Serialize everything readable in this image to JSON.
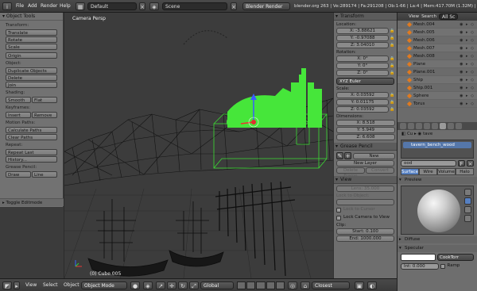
{
  "topbar": {
    "menus": [
      "File",
      "Add",
      "Render",
      "Help"
    ],
    "screen_layout": "Default",
    "scene": "Scene",
    "render_engine": "Blender Render",
    "stats": "blender.org 263 | Ve:289174 | Fa:291208 | Ob:1-66 | La:4 | Mem:417.70M (1.32M) | Cube.005"
  },
  "toolshelf": {
    "title": "Object Tools",
    "sections": {
      "transform": "Transform:",
      "object": "Object:",
      "shading": "Shading:",
      "keyframes": "Keyframes:",
      "motion_paths": "Motion Paths:",
      "repeat": "Repeat:",
      "grease_pencil": "Grease Pencil:"
    },
    "buttons": {
      "translate": "Translate",
      "rotate": "Rotate",
      "scale": "Scale",
      "origin": "Origin",
      "duplicate": "Duplicate Objects",
      "delete": "Delete",
      "join": "Join",
      "smooth": "Smooth",
      "flat": "Flat",
      "insert": "Insert",
      "remove": "Remove",
      "calc_paths": "Calculate Paths",
      "clear_paths": "Clear Paths",
      "repeat_last": "Repeat Last",
      "history": "History...",
      "draw": "Draw",
      "line": "Line"
    },
    "toggle": "Toggle Editmode"
  },
  "viewport": {
    "label": "Camera Persp",
    "active_object": "(0) Cube.005"
  },
  "npanel": {
    "transform": {
      "title": "Transform",
      "location_label": "Location:",
      "location": [
        "X: -3.88621",
        "Y: -0.97088",
        "Z: 3.04010"
      ],
      "rotation_label": "Rotation:",
      "rotation": [
        "X: 0°",
        "Y: 0°",
        "Z: 0°"
      ],
      "rotation_mode": "XYZ Euler",
      "scale_label": "Scale:",
      "scale": [
        "X: 0.03592",
        "Y: 0.01175",
        "Z: 0.03592"
      ],
      "dimensions_label": "Dimensions:",
      "dimensions": [
        "X: 8.518",
        "Y: 5.949",
        "Z: 6.608"
      ]
    },
    "grease_pencil": {
      "title": "Grease Pencil",
      "new": "New",
      "new_layer": "New Layer",
      "delete_frame": "Delete Frame",
      "convert": "Convert"
    },
    "view": {
      "title": "View",
      "lens": "Lens: 35.000",
      "lock_to_object": "Lock to Object:",
      "lock_to_cursor": "Lock to Cursor",
      "lock_camera": "Lock Camera to View",
      "clip_label": "Clip:",
      "clip_start": "Start: 0.100",
      "clip_end": "End: 1000.000"
    }
  },
  "outliner": {
    "header": {
      "view": "View",
      "search": "Search",
      "filter": "All Sc"
    },
    "items": [
      "Mesh.004",
      "Mesh.005",
      "Mesh.006",
      "Mesh.007",
      "Mesh.008",
      "Plane",
      "Plane.001",
      "Ship",
      "Ship.001",
      "Sphere",
      "Torus"
    ]
  },
  "properties": {
    "crumb_obj": "Cu",
    "crumb_mat": "tave",
    "material_slot": "tavern_bench_wood",
    "material_field": "ood",
    "tabs": [
      "Surface",
      "Wire",
      "Volume",
      "Halo"
    ],
    "preview": "Preview",
    "diffuse": "Diffuse",
    "specular": "Specular",
    "shader": "CookTorr",
    "intensity": "Int: 0.000",
    "ramp": "Ramp"
  },
  "botbar": {
    "menus": [
      "View",
      "Select",
      "Object"
    ],
    "mode": "Object Mode",
    "pivot": "Global",
    "snap": "Closest"
  }
}
